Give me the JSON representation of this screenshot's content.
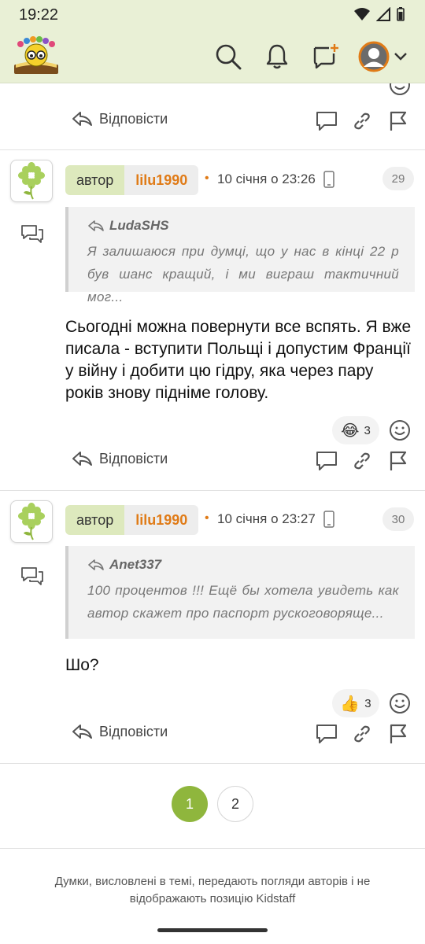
{
  "status_bar": {
    "time": "19:22"
  },
  "header": {
    "logo": "kidstaff-logo",
    "icons": [
      "search-icon",
      "bell-icon",
      "new-chat-icon",
      "user-avatar",
      "chevron-down-icon"
    ]
  },
  "colors": {
    "accent": "#8fb63d",
    "username": "#e07b17",
    "header_bg": "#e9f0d6"
  },
  "top_actions": {
    "reply_label": "Відповісти"
  },
  "posts": [
    {
      "role": "автор",
      "username": "lilu1990",
      "date": "10 січня о 23:26",
      "number": "29",
      "quote_author": "LudaSHS",
      "quote_text": "Я залишаюся при думці, що у нас в кінці 22 р був шанс кращий, і ми виграш тактичний мог...",
      "text": "Сьогодні можна повернути все вспять. Я вже писала - вступити Польщі і допустим Франції у війну і добити цю гідру, яка через пару років знову підніме голову.",
      "reaction_emoji": "😂",
      "reaction_count": "3",
      "reply_label": "Відповісти"
    },
    {
      "role": "автор",
      "username": "lilu1990",
      "date": "10 січня о 23:27",
      "number": "30",
      "quote_author": "Anet337",
      "quote_text": "100 процентов !!! Ещё бы хотела увидеть как автор скажет про паспорт рускоговоряще...",
      "text": "Шо?",
      "reaction_emoji": "👍",
      "reaction_count": "3",
      "reply_label": "Відповісти"
    }
  ],
  "pagination": {
    "pages": [
      "1",
      "2"
    ],
    "current": "1"
  },
  "footer": {
    "text": "Думки, висловлені в темі, передають погляди авторів і не відображають позицію Kidstaff"
  }
}
